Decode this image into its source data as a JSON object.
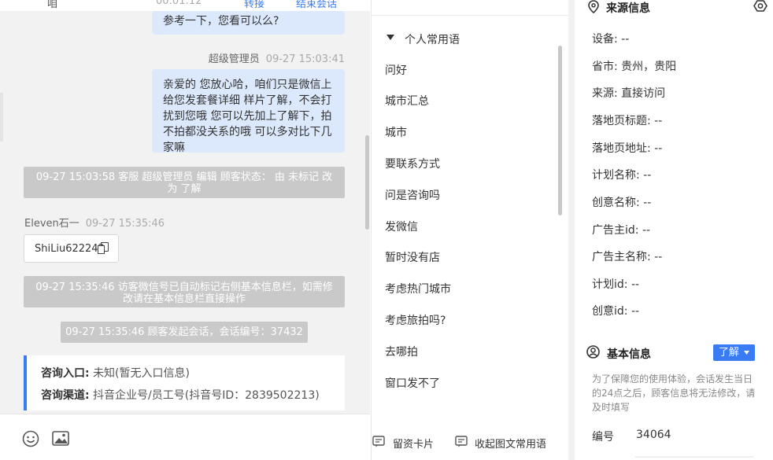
{
  "chat": {
    "top_bubble": {
      "partial_left": "咱",
      "partial_time": "00:01:12",
      "action_transfer": "转接",
      "action_end": "结束会话",
      "line1": "……",
      "line2": "参考一下，您看可以么?"
    },
    "message1": {
      "sender": "超级管理员",
      "time": "09-27 15:03:41",
      "lines": [
        "亲爱的 您放心哈，咱们只是微信上",
        "给您发套餐详细 样片了解，不会打",
        "扰到您哦 您可以先加上了解下，拍",
        "不拍都没关系的哦 可以多对比下几",
        "家嘛"
      ]
    },
    "sys1": {
      "line1": "09-27 15:03:58 客服 超级管理员 编辑 顾客状态： 由 未标记 改",
      "line2": "为 了解"
    },
    "message2": {
      "sender": "Eleven石一",
      "time": "09-27 15:35:46",
      "chip_text": "ShiLiu622242"
    },
    "sys2": {
      "line1": "09-27 15:35:46 访客微信号已自动标记右侧基本信息栏，如需修",
      "line2": "改请在基本信息栏直接操作"
    },
    "sys3": "09-27 15:35:46 顾客发起会话，会话编号：37432",
    "consult_card": {
      "entry_label": "咨询入口:",
      "entry_value": "未知(暂无入口信息)",
      "channel_label": "咨询渠道:",
      "channel_value": "抖音企业号/员工号(抖音号ID：2839502213)"
    }
  },
  "toolbar": {
    "emoji_icon": "smiley-icon",
    "image_icon": "image-icon"
  },
  "phrases": {
    "group_title": "个人常用语",
    "items": [
      "问好",
      "城市汇总",
      "城市",
      "要联系方式",
      "问是咨询吗",
      "发微信",
      "暂时没有店",
      "考虑热门城市",
      "考虑旅拍吗?",
      "去哪拍",
      "窗口发不了"
    ],
    "btn_card": "留资卡片",
    "btn_collect": "收起图文常用语"
  },
  "source_info": {
    "title": "来源信息",
    "rows": [
      {
        "label": "设备:",
        "value": "--"
      },
      {
        "label": "省市:",
        "value": "贵州，贵阳"
      },
      {
        "label": "来源:",
        "value": "直接访问"
      },
      {
        "label": "落地页标题:",
        "value": "--"
      },
      {
        "label": "落地页地址:",
        "value": "--"
      },
      {
        "label": "计划名称:",
        "value": "--"
      },
      {
        "label": "创意名称:",
        "value": "--"
      },
      {
        "label": "广告主id:",
        "value": "--"
      },
      {
        "label": "广告主名称:",
        "value": "--"
      },
      {
        "label": "计划id:",
        "value": "--"
      },
      {
        "label": "创意id:",
        "value": "--"
      }
    ]
  },
  "basic_info": {
    "title": "基本信息",
    "status_button": "了解",
    "note_lines": [
      "为了保障您的使用体验，会话发生当日",
      "的24点之后，顾客信息将无法修改，请",
      "及时填写"
    ],
    "number_label": "编号",
    "number_value": "34064"
  }
}
